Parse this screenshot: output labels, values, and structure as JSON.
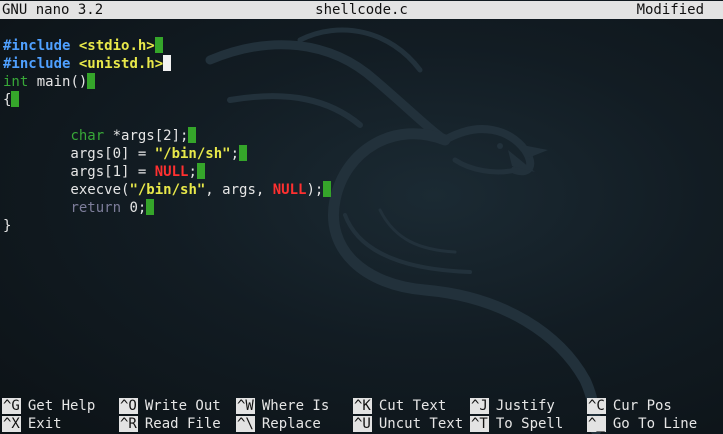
{
  "titlebar": {
    "app": "GNU nano 3.2",
    "filename": "shellcode.c",
    "status": "Modified"
  },
  "code": [
    {
      "segments": [
        {
          "t": "#include",
          "c": "kw-include"
        },
        {
          "t": " ",
          "c": "plain"
        },
        {
          "t": "<stdio.h>",
          "c": "hdr"
        }
      ],
      "trail": "ws"
    },
    {
      "segments": [
        {
          "t": "#include",
          "c": "kw-include"
        },
        {
          "t": " ",
          "c": "plain"
        },
        {
          "t": "<unistd.h>",
          "c": "hdr"
        }
      ],
      "trail": "cursor"
    },
    {
      "segments": [
        {
          "t": "int",
          "c": "kw-type"
        },
        {
          "t": " main()",
          "c": "plain"
        }
      ],
      "trail": "ws"
    },
    {
      "segments": [
        {
          "t": "{",
          "c": "plain"
        }
      ],
      "trail": "ws"
    },
    {
      "segments": [],
      "trail": ""
    },
    {
      "segments": [
        {
          "t": "        ",
          "c": "plain"
        },
        {
          "t": "char",
          "c": "kw-type"
        },
        {
          "t": " *args[2];",
          "c": "plain"
        }
      ],
      "trail": "ws"
    },
    {
      "segments": [
        {
          "t": "        args[0] = ",
          "c": "plain"
        },
        {
          "t": "\"/bin/sh\"",
          "c": "str"
        },
        {
          "t": ";",
          "c": "plain"
        }
      ],
      "trail": "ws"
    },
    {
      "segments": [
        {
          "t": "        args[1] = ",
          "c": "plain"
        },
        {
          "t": "NULL",
          "c": "null"
        },
        {
          "t": ";",
          "c": "plain"
        }
      ],
      "trail": "ws"
    },
    {
      "segments": [
        {
          "t": "        execve(",
          "c": "plain"
        },
        {
          "t": "\"/bin/sh\"",
          "c": "str"
        },
        {
          "t": ", args, ",
          "c": "plain"
        },
        {
          "t": "NULL",
          "c": "null"
        },
        {
          "t": ");",
          "c": "plain"
        }
      ],
      "trail": "ws"
    },
    {
      "segments": [
        {
          "t": "        ",
          "c": "plain"
        },
        {
          "t": "return",
          "c": "kw-return"
        },
        {
          "t": " 0;",
          "c": "plain"
        }
      ],
      "trail": "ws"
    },
    {
      "segments": [
        {
          "t": "}",
          "c": "plain"
        }
      ],
      "trail": ""
    }
  ],
  "shortcuts": {
    "row1": [
      {
        "key": "^G",
        "label": "Get Help"
      },
      {
        "key": "^O",
        "label": "Write Out"
      },
      {
        "key": "^W",
        "label": "Where Is"
      },
      {
        "key": "^K",
        "label": "Cut Text"
      },
      {
        "key": "^J",
        "label": "Justify"
      },
      {
        "key": "^C",
        "label": "Cur Pos"
      }
    ],
    "row2": [
      {
        "key": "^X",
        "label": "Exit"
      },
      {
        "key": "^R",
        "label": "Read File"
      },
      {
        "key": "^\\",
        "label": "Replace"
      },
      {
        "key": "^U",
        "label": "Uncut Text"
      },
      {
        "key": "^T",
        "label": "To Spell"
      },
      {
        "key": "^_",
        "label": "Go To Line"
      }
    ]
  },
  "colors": {
    "background": "#121c23",
    "titlebar_bg": "#e3e3e3",
    "include_keyword": "#4fa0ff",
    "header_string": "#e8e84a",
    "type_keyword": "#38a838",
    "null_literal": "#ff3030",
    "return_keyword": "#7d7d9a",
    "trailing_whitespace_marker": "#35a52a"
  }
}
